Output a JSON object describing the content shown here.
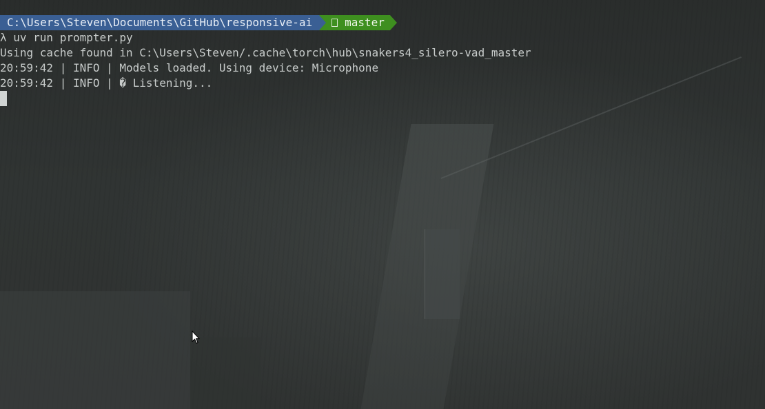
{
  "prompt": {
    "path": "C:\\Users\\Steven\\Documents\\GitHub\\responsive-ai",
    "branch_icon": "git-branch-icon",
    "branch": "master",
    "colors": {
      "path_bg": "#3a5f94",
      "branch_bg": "#3e8f1f"
    }
  },
  "lines": [
    "λ uv run prompter.py",
    "Using cache found in C:\\Users\\Steven/.cache\\torch\\hub\\snakers4_silero-vad_master",
    "20:59:42 | INFO | Models loaded. Using device: Microphone",
    "20:59:42 | INFO | � Listening..."
  ],
  "cursor_icon": "text-cursor-block",
  "pointer_icon": "mouse-pointer-icon"
}
